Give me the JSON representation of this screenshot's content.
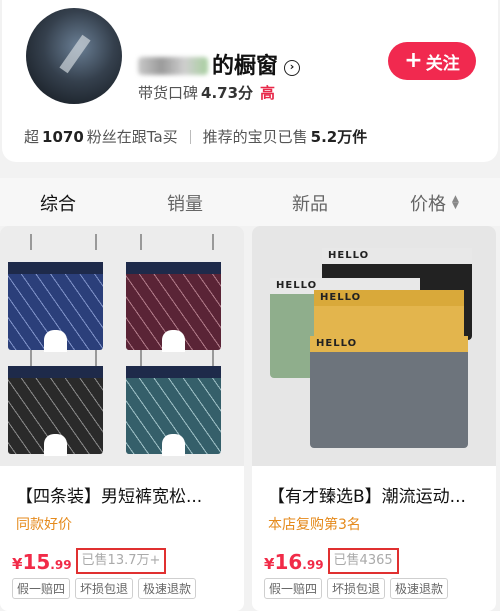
{
  "profile": {
    "shop_name": "的橱窗",
    "rating_label": "带货口碑",
    "rating_score": "4.73分",
    "rating_level": "高",
    "follow_label": "关注",
    "fans_prefix": "超",
    "fans_count": "1070",
    "fans_suffix": "粉丝在跟Ta买",
    "sold_prefix": "推荐的宝贝已售",
    "sold_count": "5.2万件"
  },
  "tabs": [
    "综合",
    "销量",
    "新品",
    "价格"
  ],
  "products": [
    {
      "title": "【四条装】男短裤宽松...",
      "tag": "同款好价",
      "price_yen": "¥",
      "price_int": "15",
      "price_dec": ".99",
      "sold": "已售13.7万+",
      "badges": [
        "假一赔四",
        "坏损包退",
        "极速退款"
      ]
    },
    {
      "title": "【有才臻选B】潮流运动...",
      "tag": "本店复购第3名",
      "price_yen": "¥",
      "price_int": "16",
      "price_dec": ".99",
      "sold": "已售4365",
      "badges": [
        "假一赔四",
        "坏损包退",
        "极速退款"
      ]
    }
  ],
  "waistband_text": [
    "HELLO",
    "HELLO",
    "HELLO",
    "HELLO"
  ],
  "colors": {
    "accent": "#f1294f",
    "price": "#f12b48",
    "tag": "#e58a1c",
    "sold_highlight": "#e03030"
  }
}
